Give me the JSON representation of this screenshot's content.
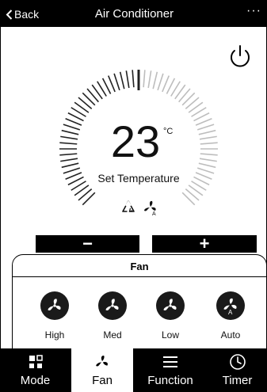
{
  "header": {
    "back_label": "Back",
    "title": "Air Conditioner",
    "more_label": "···"
  },
  "thermostat": {
    "temperature": "23",
    "unit": "°C",
    "label": "Set Temperature"
  },
  "controls": {
    "minus_label": "−",
    "plus_label": "+"
  },
  "fan_panel": {
    "title": "Fan",
    "speeds": [
      {
        "label": "High"
      },
      {
        "label": "Med"
      },
      {
        "label": "Low"
      },
      {
        "label": "Auto",
        "badge": "A"
      }
    ]
  },
  "tabs": [
    {
      "label": "Mode",
      "icon": "mode-icon"
    },
    {
      "label": "Fan",
      "icon": "fan-icon",
      "active": true
    },
    {
      "label": "Function",
      "icon": "menu-icon"
    },
    {
      "label": "Timer",
      "icon": "clock-icon"
    }
  ],
  "colors": {
    "bar": "#000000",
    "background": "#ffffff",
    "tick_active": "#222222",
    "tick_inactive": "#bdbdbd"
  }
}
